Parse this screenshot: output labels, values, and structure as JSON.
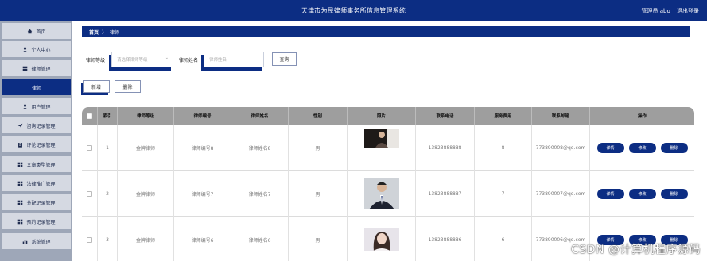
{
  "header": {
    "title": "天津市为民律师事务所信息管理系统",
    "user_label": "管理员 abo",
    "logout_label": "退出登录"
  },
  "sidebar": {
    "items": [
      {
        "label": "首页",
        "icon": "home-icon",
        "active": false
      },
      {
        "label": "个人中心",
        "icon": "user-icon",
        "active": false
      },
      {
        "label": "律师管理",
        "icon": "grid-icon",
        "active": false
      },
      {
        "label": "律师",
        "icon": "",
        "active": true
      },
      {
        "label": "用户管理",
        "icon": "user-icon",
        "active": false
      },
      {
        "label": "咨询记录管理",
        "icon": "send-icon",
        "active": false
      },
      {
        "label": "评论记录管理",
        "icon": "clipboard-icon",
        "active": false
      },
      {
        "label": "文章类型管理",
        "icon": "grid-icon",
        "active": false
      },
      {
        "label": "法律推广管理",
        "icon": "grid-icon",
        "active": false
      },
      {
        "label": "分配记录管理",
        "icon": "grid-icon",
        "active": false
      },
      {
        "label": "预约记录管理",
        "icon": "grid-icon",
        "active": false
      },
      {
        "label": "系统管理",
        "icon": "bar-chart-icon",
        "active": false
      }
    ]
  },
  "breadcrumb": {
    "home": "首页",
    "sep": "〉",
    "current": "律师"
  },
  "filters": {
    "level_label": "律师等级",
    "level_placeholder": "请选择律师等级",
    "name_label": "律师姓名",
    "name_placeholder": "律师姓名",
    "search_label": "查询"
  },
  "actions": {
    "add_label": "新增",
    "delete_label": "删除"
  },
  "table": {
    "columns": [
      "索引",
      "律师等级",
      "律师编号",
      "律师姓名",
      "性别",
      "照片",
      "联系电话",
      "服务费用",
      "联系邮箱",
      "操作"
    ],
    "rows": [
      {
        "index": "1",
        "level": "金牌律师",
        "code": "律师编号8",
        "name": "律师姓名8",
        "gender": "男",
        "phone": "13823888888",
        "fee": "8",
        "email": "773890008@qq.com"
      },
      {
        "index": "2",
        "level": "金牌律师",
        "code": "律师编号7",
        "name": "律师姓名7",
        "gender": "男",
        "phone": "13823888887",
        "fee": "7",
        "email": "773890007@qq.com"
      },
      {
        "index": "3",
        "level": "金牌律师",
        "code": "律师编号6",
        "name": "律师姓名6",
        "gender": "男",
        "phone": "13823888886",
        "fee": "6",
        "email": "773890006@qq.com"
      }
    ],
    "op_labels": {
      "detail": "详情",
      "edit": "修改",
      "delete": "删除"
    }
  },
  "watermark": "CSDN @计算机程序源码",
  "colors": {
    "primary": "#0c2d83",
    "sidebar_bg": "#9ea7b8",
    "table_header": "#9e9e9e"
  }
}
